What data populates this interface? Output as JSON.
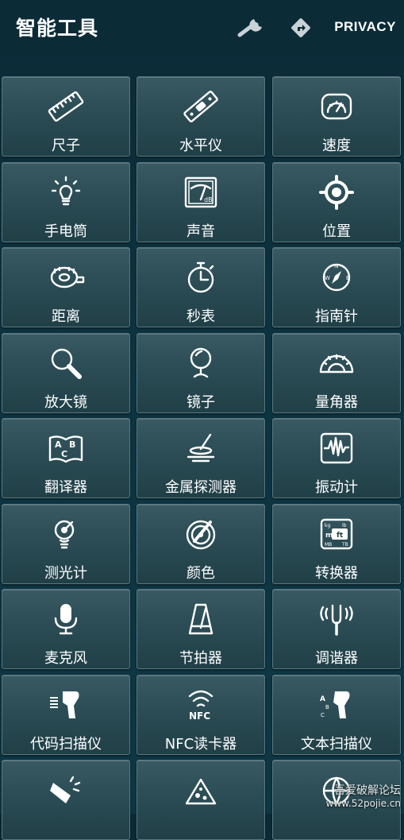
{
  "header": {
    "title": "智能工具",
    "wrench_icon": "wrench-icon",
    "directions_icon": "directions-icon",
    "privacy_label": "PRIVACY"
  },
  "tools": [
    {
      "label": "尺子",
      "icon": "ruler-icon"
    },
    {
      "label": "水平仪",
      "icon": "level-icon"
    },
    {
      "label": "速度",
      "icon": "speedometer-icon"
    },
    {
      "label": "手电筒",
      "icon": "flashlight-icon"
    },
    {
      "label": "声音",
      "icon": "sound-meter-icon"
    },
    {
      "label": "位置",
      "icon": "location-icon"
    },
    {
      "label": "距离",
      "icon": "tape-measure-icon"
    },
    {
      "label": "秒表",
      "icon": "stopwatch-icon"
    },
    {
      "label": "指南针",
      "icon": "compass-icon"
    },
    {
      "label": "放大镜",
      "icon": "magnifier-icon"
    },
    {
      "label": "镜子",
      "icon": "mirror-icon"
    },
    {
      "label": "量角器",
      "icon": "protractor-icon"
    },
    {
      "label": "翻译器",
      "icon": "translator-icon"
    },
    {
      "label": "金属探测器",
      "icon": "metal-detector-icon"
    },
    {
      "label": "振动计",
      "icon": "vibrometer-icon"
    },
    {
      "label": "测光计",
      "icon": "light-meter-icon"
    },
    {
      "label": "颜色",
      "icon": "color-picker-icon"
    },
    {
      "label": "转换器",
      "icon": "unit-converter-icon"
    },
    {
      "label": "麦克风",
      "icon": "microphone-icon"
    },
    {
      "label": "节拍器",
      "icon": "metronome-icon"
    },
    {
      "label": "调谐器",
      "icon": "tuning-fork-icon"
    },
    {
      "label": "代码扫描仪",
      "icon": "barcode-scanner-icon"
    },
    {
      "label": "NFC读卡器",
      "icon": "nfc-icon"
    },
    {
      "label": "文本扫描仪",
      "icon": "text-scanner-icon"
    },
    {
      "label": "",
      "icon": "pointer-icon"
    },
    {
      "label": "",
      "icon": "pizza-icon"
    },
    {
      "label": "",
      "icon": "globe-icon"
    }
  ],
  "watermark": {
    "line1": "吾爱破解论坛",
    "line2": "www.52pojie.cn"
  }
}
